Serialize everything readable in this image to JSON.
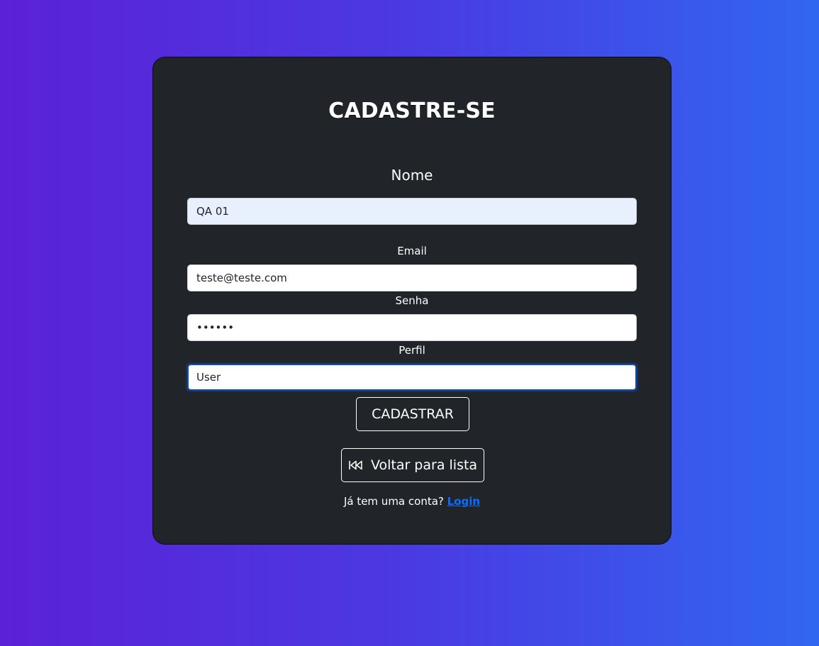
{
  "form": {
    "title": "CADASTRE-SE",
    "name_label": "Nome",
    "name_value": "QA 01",
    "email_label": "Email",
    "email_value": "teste@teste.com",
    "password_label": "Senha",
    "password_value": "••••••",
    "profile_label": "Perfil",
    "profile_value": "User",
    "submit_label": "CADASTRAR",
    "back_label": "Voltar para lista",
    "back_icon": "rewind-icon",
    "footer_text": "Já tem uma conta? ",
    "login_link": "Login"
  },
  "colors": {
    "card_background": "#212529",
    "link": "#0d6efd",
    "gradient_start": "#5b21d6",
    "gradient_end": "#3166f0"
  }
}
